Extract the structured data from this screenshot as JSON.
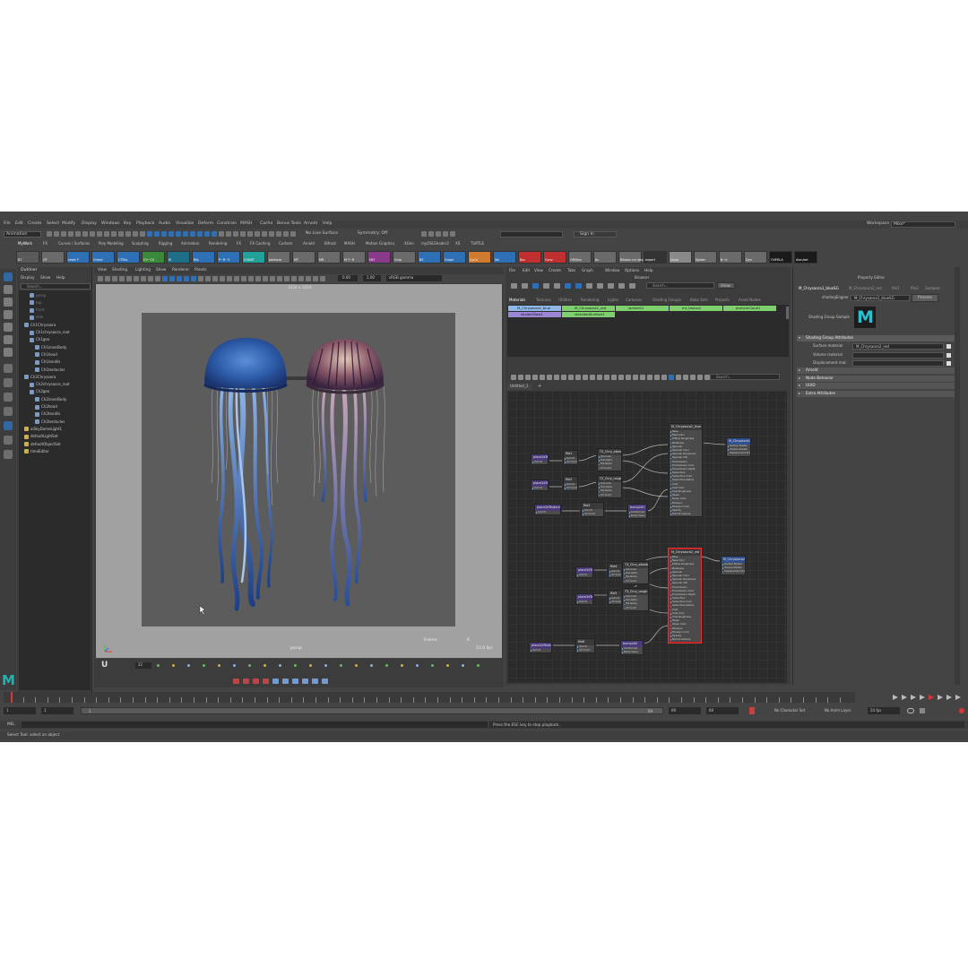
{
  "menubar": {
    "items": [
      "File",
      "Edit",
      "Create",
      "Select",
      "Modify",
      "Display",
      "Windows",
      "Key",
      "Playback",
      "Audio",
      "Visualize",
      "Deform",
      "Constrain",
      "MASH",
      "Cache",
      "Bonus Tools",
      "Arnold",
      "Help"
    ],
    "workspace_label": "Workspace :",
    "workspace_value": "Mike*"
  },
  "statusline": {
    "mode": "Animation",
    "live_surface": "No Live Surface",
    "symmetry": "Symmetry: Off",
    "sign_in": "Sign In"
  },
  "shelf": {
    "tabs": [
      "MyWork",
      "FX",
      "Curves / Surfaces",
      "Poly Modeling",
      "Sculpting",
      "Rigging",
      "Animation",
      "Rendering",
      "FX",
      "FX Caching",
      "Custom",
      "Arnold",
      "Bifrost",
      "MASH",
      "Motion Graphics",
      "XGen",
      "myOSLShader2",
      "XS",
      "TURTLE"
    ],
    "buttons": [
      "B7",
      "CP",
      "reset P",
      "Orient",
      "CTRLs",
      "CV~CV",
      "IK",
      "Rfa",
      "P~R~S",
      "CONST",
      "Jointsize",
      "MT",
      "MR",
      "M T~R",
      "MLT",
      "Cmp",
      "BS",
      "Graph",
      "CpCrl",
      "Sel",
      "Bsc",
      "Conv",
      "Off/Seq",
      "bc",
      "Ribbon cvr deg2",
      "export",
      "Cone",
      "Spider",
      "B~rl",
      "Dyn",
      "OVERLA",
      "Alan/sel"
    ]
  },
  "outliner": {
    "title": "Outliner",
    "menu": [
      "Display",
      "Show",
      "Help"
    ],
    "search_placeholder": "Search...",
    "items": [
      "persp",
      "top",
      "front",
      "side",
      "Ch1Chrysaora",
      "Ch1chrysaora_root",
      "Ch1geo",
      "Ch1innerBody",
      "Ch1head",
      "Ch1tendils",
      "Ch1tentacles",
      "Ch2Chrysaora",
      "Ch2chrysaora_root",
      "Ch2geo",
      "Ch2innerBody",
      "Ch2head",
      "Ch2tendils",
      "Ch2tentacles",
      "aiSkyDomeLight1",
      "defaultLightSet",
      "defaultObjectSet",
      "timeEditor"
    ]
  },
  "viewport": {
    "menu": [
      "View",
      "Shading",
      "Lighting",
      "Show",
      "Renderer",
      "Panels"
    ],
    "resolution": "1024 x 1024",
    "camera_label": "persp",
    "frame_label": "Frame:",
    "frame_value": "6",
    "fps_value": "23.0 fps",
    "field_1": "0.00",
    "field_2": "1.00",
    "colorspace": "sRGB gamma",
    "frame_field": "22"
  },
  "hypershade": {
    "menu": [
      "File",
      "Edit",
      "View",
      "Create",
      "Tabs",
      "Graph",
      "Window",
      "Options",
      "Help"
    ],
    "browser_title": "Browser",
    "browser_search_placeholder": "Search...",
    "show_button": "Show",
    "tabs": [
      "Materials",
      "Textures",
      "Utilities",
      "Rendering",
      "Lights",
      "Cameras",
      "Shading Groups",
      "Bake Sets",
      "Projects",
      "Asset Nodes"
    ],
    "materials": [
      "M_Chrysaora1_blue",
      "M_Chrysaora2_red",
      "lambert1",
      "mt_texture",
      "particleCloud1"
    ],
    "materials_row2": [
      "shaderGlow1",
      "standardSurface1"
    ],
    "graph_tab": "Untitled_1",
    "graph_search_placeholder": "Search...",
    "nodes": {
      "place1": "place2dTexture1",
      "file1": "file1",
      "tex1": "T2_Chry_albedo",
      "place2": "place2dTexture2",
      "file2": "file2",
      "tex2": "T2_Chry_rough",
      "place3": "place2dTexture3",
      "file3": "file3",
      "tex3": "T2_Chry_normal",
      "bump1": "bump2d1",
      "shader1": "M_Chrysaora1_blue",
      "sg1": "M_Chrysaora1_blueSG",
      "place4": "place2dTexture4",
      "file4": "file4",
      "tex4": "T3_Chry_albedo",
      "place5": "place2dTexture5",
      "file5": "file5",
      "tex5": "T3_Chry_rough",
      "place6": "place2dTexture6",
      "file6": "file6",
      "tex6": "T3_Chry_normal",
      "bump2": "bump2d2",
      "shader2": "M_Chrysaora2_red",
      "sg2": "M_Chrysaora2_redSG"
    },
    "shader_attrs": [
      "Base",
      "Base Color",
      "Diffuse Roughness",
      "Metalness",
      "Specular",
      "Specular Color",
      "Specular Roughness",
      "Specular IOR",
      "Transmission",
      "Transmission Color",
      "Transmission Depth",
      "Subsurface",
      "Subsurface Color",
      "Subsurface Radius",
      "Coat",
      "Coat Color",
      "Coat Roughness",
      "Sheen",
      "Sheen Color",
      "Emission",
      "Emission Color",
      "Opacity",
      "Normal Camera"
    ],
    "sg_attrs": [
      "Surface Shader",
      "Volume Shader",
      "Displacement Shader"
    ],
    "tex_attrs": [
      "Out Color",
      "Out Alpha",
      "File Name",
      "UV Coord"
    ],
    "file_attrs": [
      "Out UV",
      "UV Coord"
    ],
    "bump_attrs": [
      "Out Normal",
      "Bump Value"
    ]
  },
  "property_editor": {
    "title": "Property Editor",
    "tabs": [
      "M_Chrysaora1_blueSG",
      "M_Chrysaora2_red",
      "file1",
      "file3",
      "Samples"
    ],
    "node_type_label": "shadingEngine",
    "node_name": "M_Chrysaora1_blueSG",
    "presets_button": "Presets",
    "sample_label": "Shading Group Sample",
    "logo_letter": "M",
    "section_attrs": "Shading Group Attributes",
    "attr_labels": [
      "Surface material",
      "Volume material",
      "Displacement mat."
    ],
    "attr_values": [
      "M_Chrysaora2_red",
      "",
      ""
    ],
    "collapsed_sections": [
      "Arnold",
      "Node Behavior",
      "UUID",
      "Extra Attributes"
    ],
    "side_tabs": [
      "Channel Box / Layer Editor",
      "Attribute Editor",
      "Tool Settings",
      "Modelling Toolkit"
    ]
  },
  "timeline": {
    "range_start": "1",
    "range_start2": "1",
    "range_field": "1",
    "range_end": "69",
    "range_end2": "69",
    "range_end3": "69",
    "character_set": "No Character Set",
    "anim_layer": "No Anim Layer",
    "fps": "24 fps"
  },
  "commandline": {
    "mel_label": "MEL",
    "message": "Press the ESC key to stop playback.",
    "help_line": "Select Tool: select an object"
  },
  "colors": {
    "app_bg": "#444444",
    "panel_bg": "#3c3c3c",
    "viewport_bg": "#a0a0a0",
    "render_bg": "#5a5a5a",
    "node_graph_bg": "#2b2b2b",
    "shelf_blue": "#2f6fb5",
    "material_green": "#7fcf6f",
    "material_purple": "#9b86d6",
    "accent_red": "#d33"
  }
}
